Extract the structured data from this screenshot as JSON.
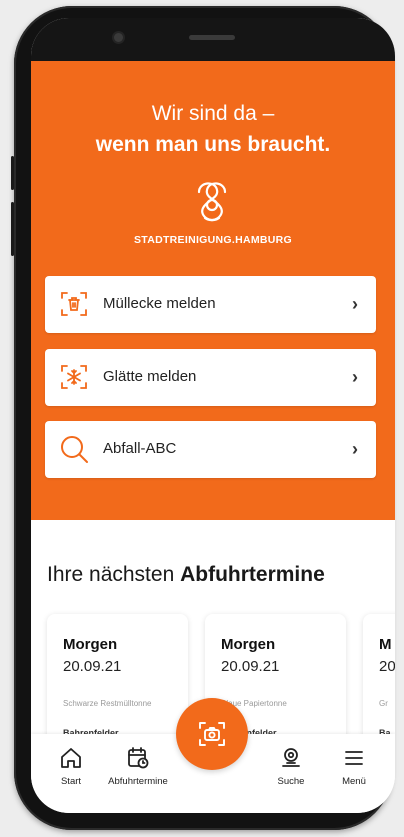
{
  "hero": {
    "tagline_line1": "Wir sind da –",
    "tagline_line2": "wenn man uns braucht.",
    "brand": "STADTREINIGUNG.HAMBURG"
  },
  "actions": [
    {
      "label": "Müllecke melden",
      "icon": "trash-report-icon"
    },
    {
      "label": "Glätte melden",
      "icon": "snowflake-report-icon"
    },
    {
      "label": "Abfall-ABC",
      "icon": "search-icon"
    }
  ],
  "section": {
    "title_regular": "Ihre nächsten ",
    "title_bold": "Abfuhrtermine"
  },
  "cards": [
    {
      "day": "Morgen",
      "date": "20.09.21",
      "type": "Schwarze Restmülltonne",
      "location": "Bahrenfelder"
    },
    {
      "day": "Morgen",
      "date": "20.09.21",
      "type": "Blaue Papiertonne",
      "location": "Bahrenfelder"
    },
    {
      "day": "M",
      "date": "20",
      "type": "Gr",
      "location": "Ba"
    }
  ],
  "tabbar": {
    "start": "Start",
    "abfuhrtermine": "Abfuhrtermine",
    "suche": "Suche",
    "menu": "Menü"
  },
  "colors": {
    "accent": "#f26a1b",
    "background": "#ffffff",
    "frame": "#121212"
  }
}
